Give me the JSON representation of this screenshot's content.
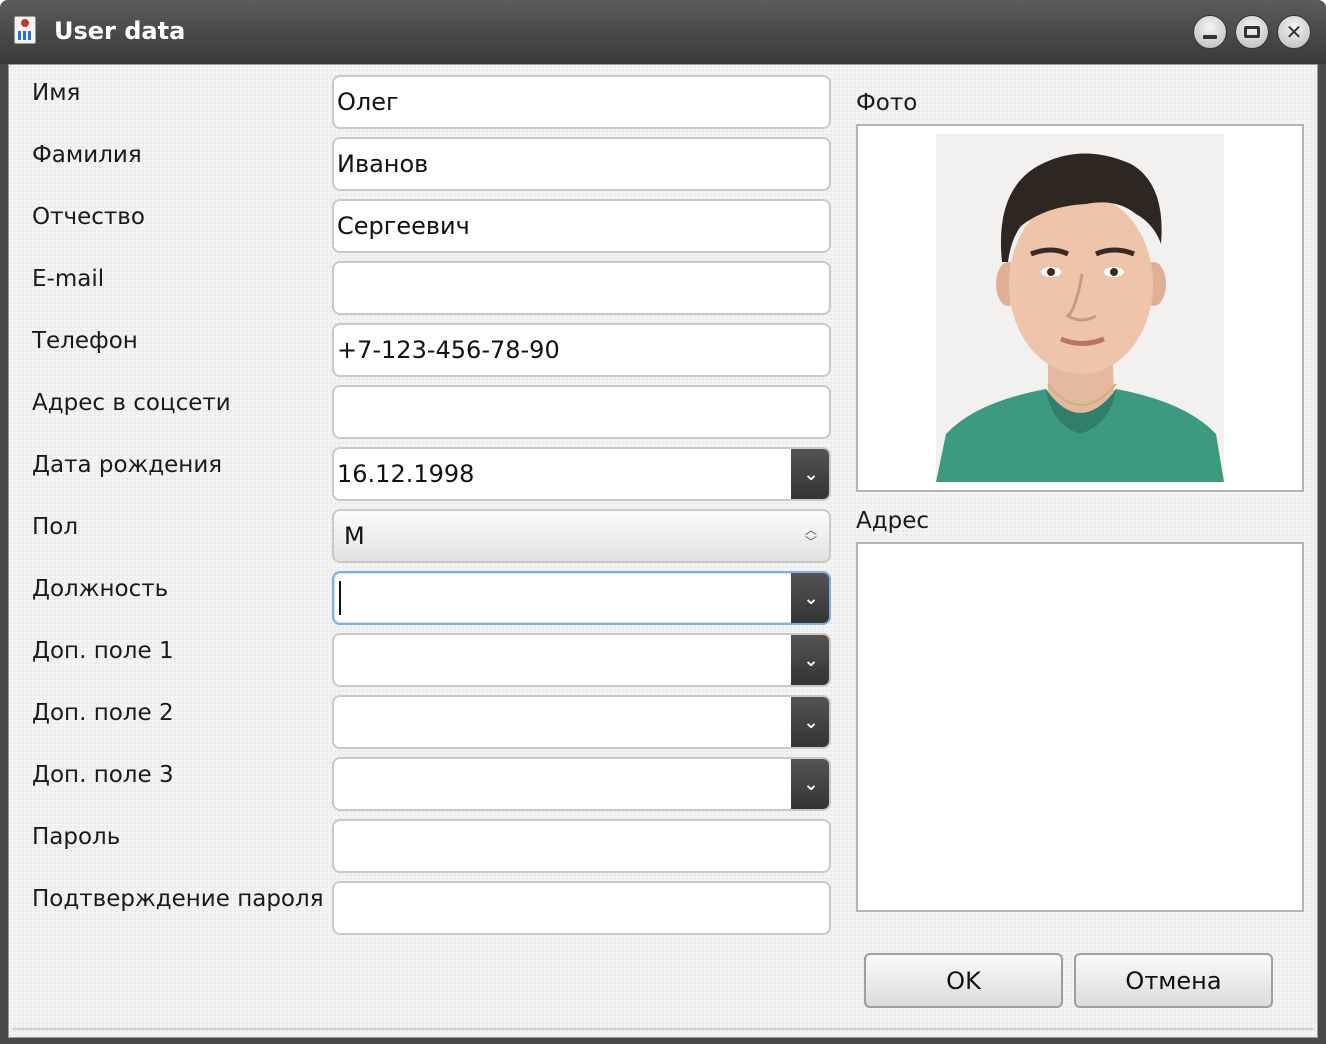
{
  "window": {
    "title": "User data"
  },
  "form": {
    "fields": [
      {
        "label": "Имя",
        "value": "Олег"
      },
      {
        "label": "Фамилия",
        "value": "Иванов"
      },
      {
        "label": "Отчество",
        "value": "Сергеевич"
      },
      {
        "label": "E-mail",
        "value": ""
      },
      {
        "label": "Телефон",
        "value": "+7-123-456-78-90"
      },
      {
        "label": "Адрес в соцсети",
        "value": ""
      },
      {
        "label": "Дата рождения",
        "value": "16.12.1998"
      },
      {
        "label": "Пол",
        "value": "М"
      },
      {
        "label": "Должность",
        "value": ""
      },
      {
        "label": "Доп. поле 1",
        "value": ""
      },
      {
        "label": "Доп. поле 2",
        "value": ""
      },
      {
        "label": "Доп. поле 3",
        "value": ""
      },
      {
        "label": "Пароль",
        "value": ""
      },
      {
        "label": "Подтверждение пароля",
        "value": ""
      }
    ]
  },
  "photo": {
    "label": "Фото"
  },
  "address": {
    "label": "Адрес",
    "value": ""
  },
  "buttons": {
    "ok": "OK",
    "cancel": "Отмена"
  },
  "colors": {
    "titlebar": "#3a3a3a",
    "dropdown_button": "#3f3f3f",
    "focus_border": "#7fb0e0",
    "shirt": "#3d9a80"
  }
}
